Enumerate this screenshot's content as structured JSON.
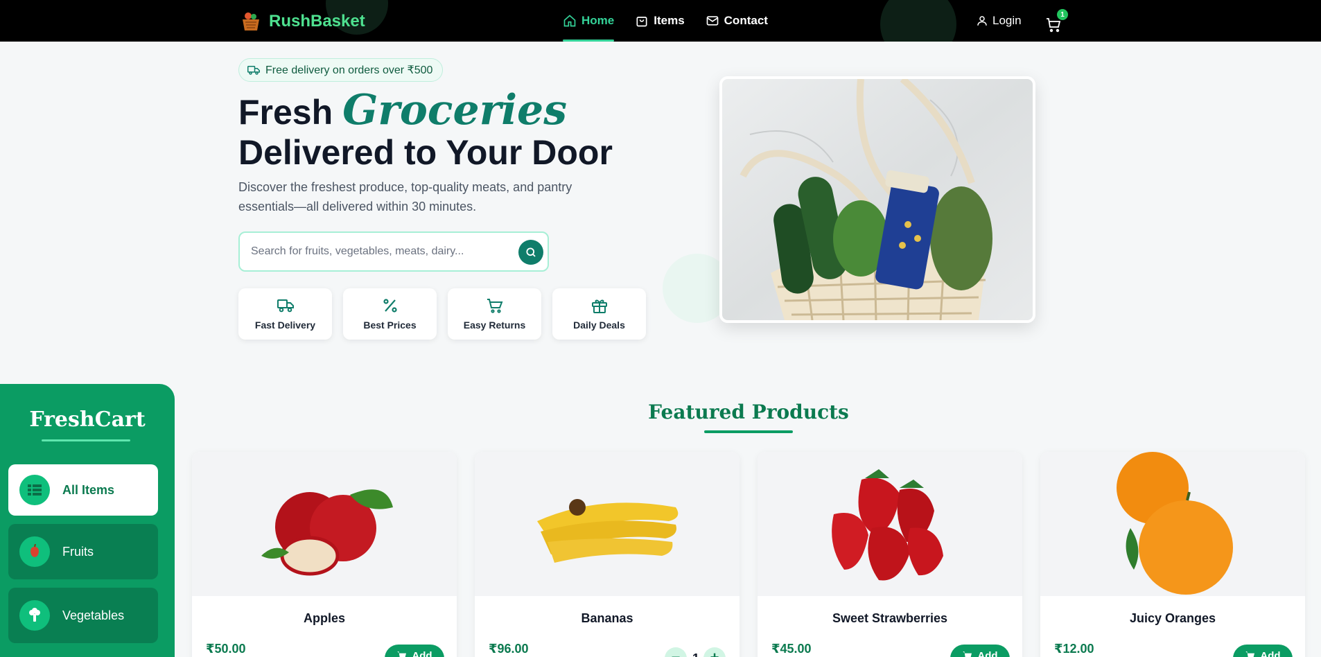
{
  "nav": {
    "brand": "RushBasket",
    "links": [
      {
        "label": "Home",
        "icon": "home-icon",
        "active": true
      },
      {
        "label": "Items",
        "icon": "shopping-bag-icon",
        "active": false
      },
      {
        "label": "Contact",
        "icon": "mail-icon",
        "active": false
      }
    ],
    "login_label": "Login",
    "cart_count": "1"
  },
  "hero": {
    "promo": "Free delivery on orders over ₹500",
    "title_part1": "Fresh ",
    "title_accent": "Groceries",
    "title_line2": "Delivered to Your Door",
    "description": "Discover the freshest produce, top-quality meats, and pantry essentials—all delivered within 30 minutes.",
    "search_placeholder": "Search for fruits, vegetables, meats, dairy...",
    "features": [
      {
        "label": "Fast Delivery",
        "icon": "truck-icon"
      },
      {
        "label": "Best Prices",
        "icon": "percent-icon"
      },
      {
        "label": "Easy Returns",
        "icon": "cart-icon"
      },
      {
        "label": "Daily Deals",
        "icon": "gift-icon"
      }
    ]
  },
  "sidebar": {
    "title": "FreshCart",
    "items": [
      {
        "label": "All Items",
        "icon": "grid-icon",
        "active": true
      },
      {
        "label": "Fruits",
        "icon": "fruit-icon",
        "active": false
      },
      {
        "label": "Vegetables",
        "icon": "broccoli-icon",
        "active": false
      }
    ]
  },
  "featured": {
    "title": "Featured Products",
    "add_label": "Add",
    "products": [
      {
        "name": "Apples",
        "price": "₹50.00",
        "in_cart": false
      },
      {
        "name": "Bananas",
        "price": "₹96.00",
        "in_cart": true,
        "qty": "1"
      },
      {
        "name": "Sweet Strawberries",
        "price": "₹45.00",
        "in_cart": false
      },
      {
        "name": "Juicy Oranges",
        "price": "₹12.00",
        "in_cart": false
      }
    ]
  },
  "colors": {
    "accent": "#0b9c63",
    "brand_green": "#4ee08f",
    "nav_bg": "#000000",
    "title_teal": "#0f7d6a"
  }
}
